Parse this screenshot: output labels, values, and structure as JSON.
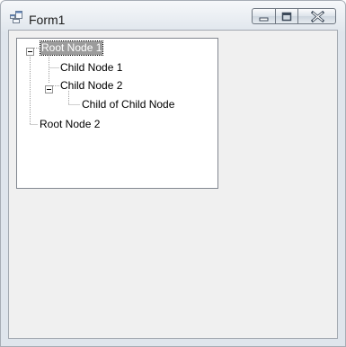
{
  "window": {
    "title": "Form1"
  },
  "tree": {
    "nodes": [
      {
        "label": "Root Node 1",
        "level": 0,
        "expanded": true,
        "selected": true
      },
      {
        "label": "Child Node 1",
        "level": 1,
        "expanded": false,
        "selected": false
      },
      {
        "label": "Child Node 2",
        "level": 1,
        "expanded": true,
        "selected": false
      },
      {
        "label": "Child of Child Node",
        "level": 2,
        "expanded": false,
        "selected": false
      },
      {
        "label": "Root Node 2",
        "level": 0,
        "expanded": false,
        "selected": false
      }
    ]
  },
  "icons": {
    "app": "form-app-icon",
    "minimize": "minimize-icon",
    "maximize": "maximize-icon",
    "close": "close-icon",
    "collapse": "minus-expander-icon"
  }
}
